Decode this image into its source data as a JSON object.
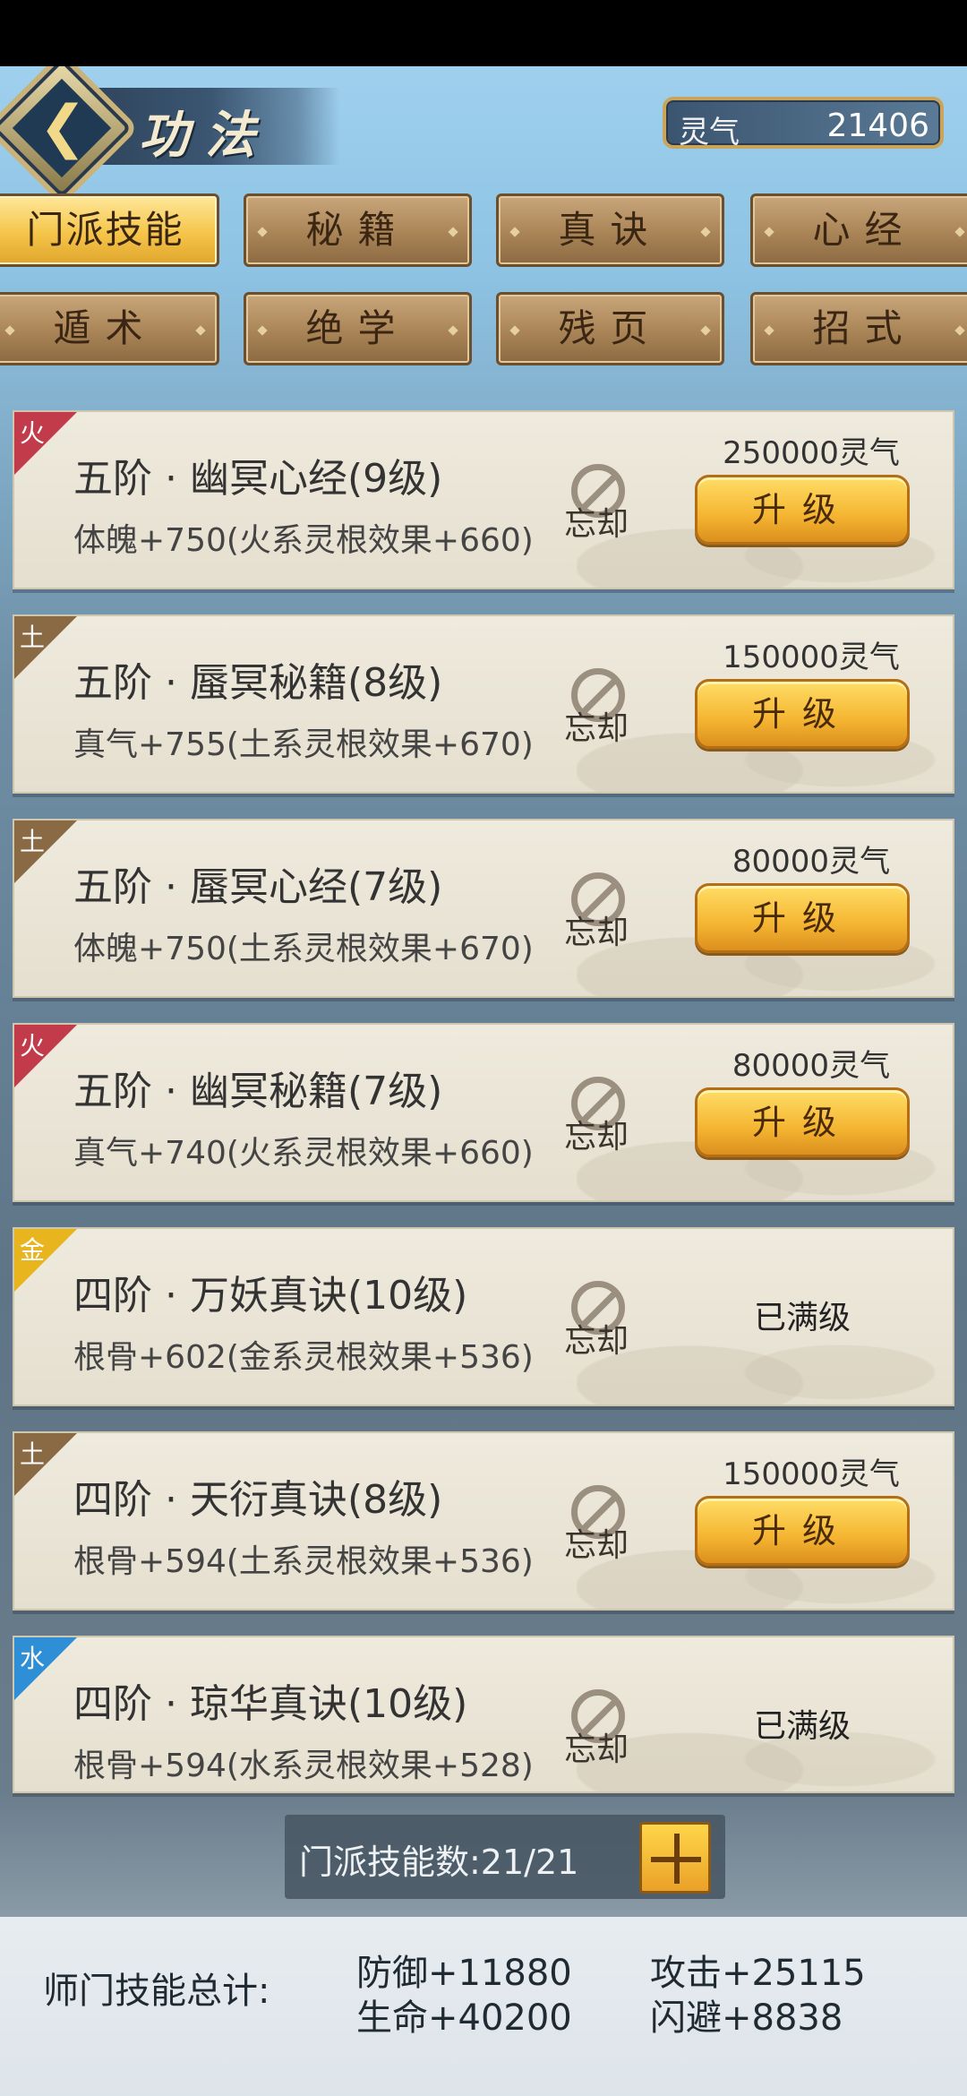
{
  "header": {
    "title": "功法",
    "spirit_label": "灵气",
    "spirit_value": "21406"
  },
  "tabs": [
    {
      "label": "门派技能",
      "active": true
    },
    {
      "label": "秘籍",
      "active": false
    },
    {
      "label": "真诀",
      "active": false
    },
    {
      "label": "心经",
      "active": false
    },
    {
      "label": "遁术",
      "active": false
    },
    {
      "label": "绝学",
      "active": false
    },
    {
      "label": "残页",
      "active": false
    },
    {
      "label": "招式",
      "active": false
    }
  ],
  "skills": [
    {
      "element": "火",
      "element_color": "#c23b4a",
      "title": "五阶 · 幽冥心经(9级)",
      "desc": "体魄+750(火系灵根效果+660)",
      "forget": "忘却",
      "cost": "250000灵气",
      "action": "升级",
      "maxed": false
    },
    {
      "element": "土",
      "element_color": "#8a6a44",
      "title": "五阶 · 蜃冥秘籍(8级)",
      "desc": "真气+755(土系灵根效果+670)",
      "forget": "忘却",
      "cost": "150000灵气",
      "action": "升级",
      "maxed": false
    },
    {
      "element": "土",
      "element_color": "#8a6a44",
      "title": "五阶 · 蜃冥心经(7级)",
      "desc": "体魄+750(土系灵根效果+670)",
      "forget": "忘却",
      "cost": "80000灵气",
      "action": "升级",
      "maxed": false
    },
    {
      "element": "火",
      "element_color": "#c23b4a",
      "title": "五阶 · 幽冥秘籍(7级)",
      "desc": "真气+740(火系灵根效果+660)",
      "forget": "忘却",
      "cost": "80000灵气",
      "action": "升级",
      "maxed": false
    },
    {
      "element": "金",
      "element_color": "#e8b51e",
      "title": "四阶 · 万妖真诀(10级)",
      "desc": "根骨+602(金系灵根效果+536)",
      "forget": "忘却",
      "cost": "",
      "action": "已满级",
      "maxed": true
    },
    {
      "element": "土",
      "element_color": "#8a6a44",
      "title": "四阶 · 天衍真诀(8级)",
      "desc": "根骨+594(土系灵根效果+536)",
      "forget": "忘却",
      "cost": "150000灵气",
      "action": "升级",
      "maxed": false
    },
    {
      "element": "水",
      "element_color": "#2f8fd6",
      "title": "四阶 · 琼华真诀(10级)",
      "desc": "根骨+594(水系灵根效果+528)",
      "forget": "忘却",
      "cost": "",
      "action": "已满级",
      "maxed": true
    }
  ],
  "counter": {
    "text": "门派技能数:21/21"
  },
  "summary": {
    "label": "师门技能总计:",
    "defense": "防御+11880",
    "attack": "攻击+25115",
    "hp": "生命+40200",
    "dodge": "闪避+8838"
  }
}
